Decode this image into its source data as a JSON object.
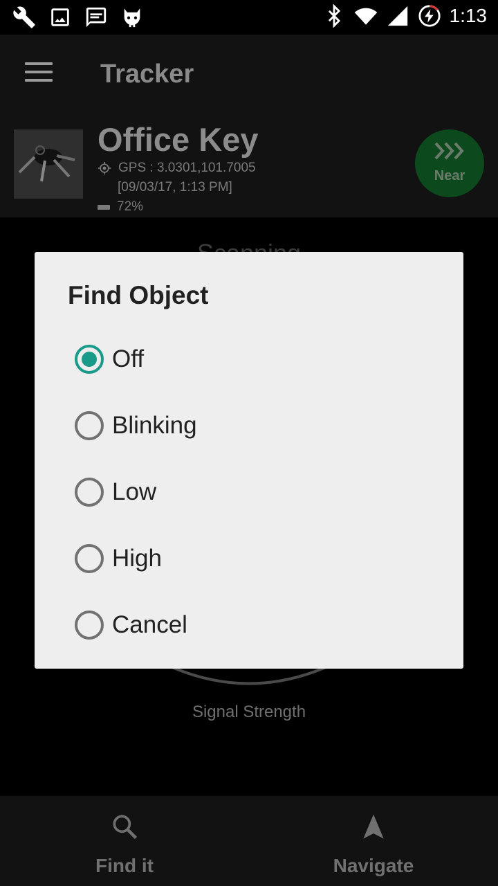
{
  "status_bar": {
    "time": "1:13",
    "left_icons": [
      "wrench-icon",
      "image-icon",
      "message-icon",
      "cyanogen-icon"
    ],
    "right_icons": [
      "bluetooth-icon",
      "wifi-icon",
      "signal-icon",
      "battery-charging-icon"
    ]
  },
  "app_bar": {
    "title": "Tracker",
    "menu_icon": "hamburger-menu-icon"
  },
  "object": {
    "name": "Office Key",
    "gps": "GPS : 3.0301,101.7005",
    "timestamp": "[09/03/17, 1:13 PM]",
    "battery": "72%",
    "proximity_label": "Near"
  },
  "background": {
    "scanning_text": "Scanning",
    "signal_label": "Signal Strength"
  },
  "dialog": {
    "title": "Find Object",
    "options": [
      {
        "label": "Off",
        "selected": true
      },
      {
        "label": "Blinking",
        "selected": false
      },
      {
        "label": "Low",
        "selected": false
      },
      {
        "label": "High",
        "selected": false
      },
      {
        "label": "Cancel",
        "selected": false
      }
    ],
    "accent_color": "#1a9b89"
  },
  "bottom_nav": {
    "items": [
      {
        "label": "Find it",
        "icon": "search-icon"
      },
      {
        "label": "Navigate",
        "icon": "navigation-arrow-icon"
      }
    ]
  }
}
